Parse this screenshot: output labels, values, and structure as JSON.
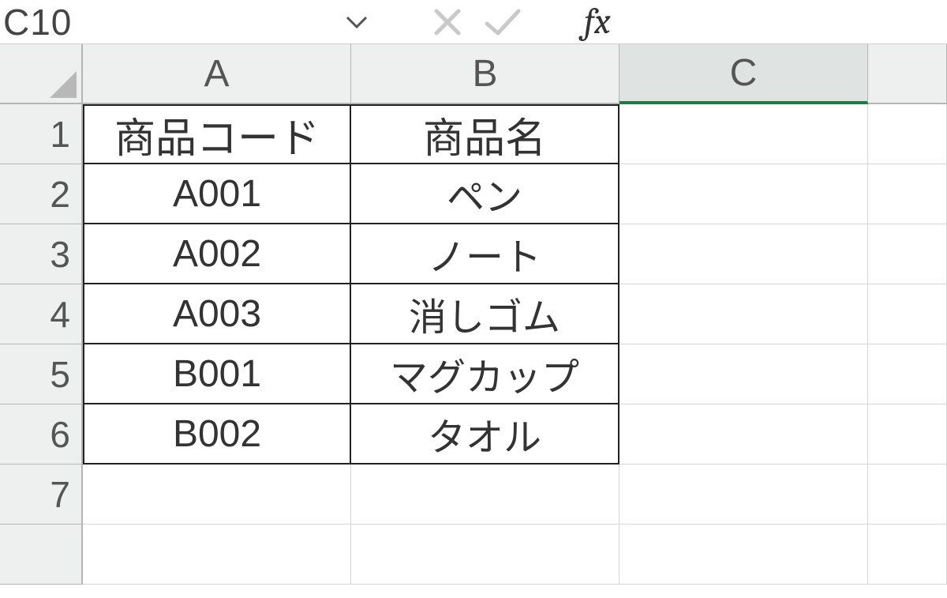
{
  "name_box": {
    "value": "C10"
  },
  "formula_bar": {
    "value": "",
    "fx_label": "fx"
  },
  "columns": [
    "A",
    "B",
    "C"
  ],
  "selected_column": "C",
  "row_numbers": [
    1,
    2,
    3,
    4,
    5,
    6,
    7
  ],
  "table": {
    "headers": {
      "A": "商品コード",
      "B": "商品名"
    },
    "rows": [
      {
        "A": "A001",
        "B": "ペン"
      },
      {
        "A": "A002",
        "B": "ノート"
      },
      {
        "A": "A003",
        "B": "消しゴム"
      },
      {
        "A": "B001",
        "B": "マグカップ"
      },
      {
        "A": "B002",
        "B": "タオル"
      }
    ]
  }
}
